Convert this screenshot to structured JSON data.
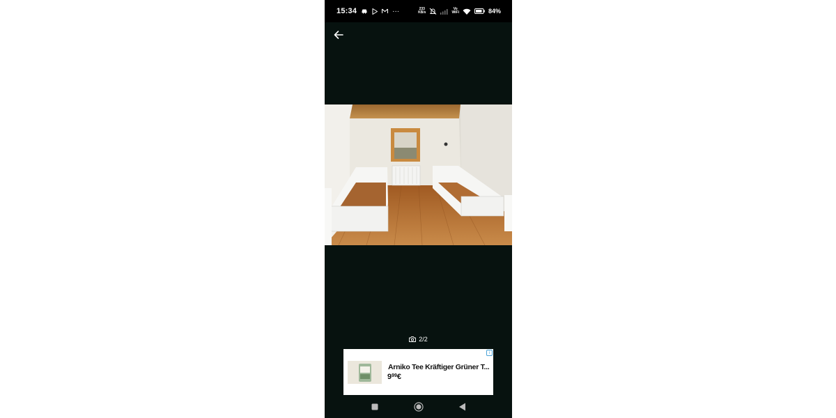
{
  "status_bar": {
    "time": "15:34",
    "more": "···",
    "data_rate_value": "233",
    "data_rate_unit": "KB/s",
    "volte_top": "Vo",
    "volte_bottom": "WiFi",
    "battery": "84%",
    "icons": [
      "car-icon",
      "play-store-icon",
      "gmail-icon",
      "mute-icon",
      "signal-icon",
      "wifi-icon",
      "battery-icon"
    ]
  },
  "toolbar": {
    "back_icon": "arrow-left-icon"
  },
  "gallery": {
    "counter": "2/2",
    "counter_icon": "camera-icon"
  },
  "ad": {
    "title": "Arniko Tee Kräftiger Grüner T...",
    "price_main": "9",
    "price_cents": "99",
    "price_currency": "€",
    "badge": "i"
  },
  "nav": {
    "icons": [
      "recent-apps-icon",
      "home-icon",
      "back-icon"
    ]
  },
  "colors": {
    "background": "#07120f",
    "page": "#ffffff",
    "floor": "#b86f2f",
    "ceiling": "#b07a3c",
    "wall": "#ece9e2"
  }
}
